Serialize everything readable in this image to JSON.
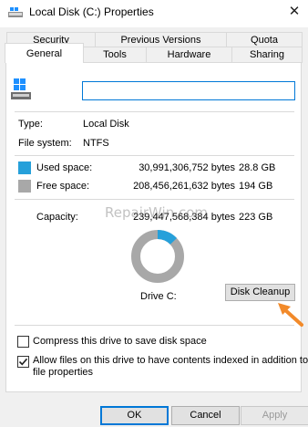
{
  "window": {
    "title": "Local Disk (C:) Properties",
    "close_glyph": "✕"
  },
  "tabs_top": [
    {
      "label": "Security"
    },
    {
      "label": "Previous Versions"
    },
    {
      "label": "Quota"
    }
  ],
  "tabs_bottom": [
    {
      "label": "General",
      "active": true
    },
    {
      "label": "Tools"
    },
    {
      "label": "Hardware"
    },
    {
      "label": "Sharing"
    }
  ],
  "general": {
    "drive_icon": "drive-icon",
    "name_value": "",
    "type_label": "Type:",
    "type_value": "Local Disk",
    "fs_label": "File system:",
    "fs_value": "NTFS",
    "used": {
      "label": "Used space:",
      "bytes": "30,991,306,752 bytes",
      "size": "28.8 GB",
      "color": "#26a0da"
    },
    "free": {
      "label": "Free space:",
      "bytes": "208,456,261,632 bytes",
      "size": "194 GB",
      "color": "#a8a8a8"
    },
    "capacity": {
      "label": "Capacity:",
      "bytes": "239,447,568,384 bytes",
      "size": "223 GB"
    },
    "used_fraction": 0.129,
    "drive_label": "Drive C:",
    "cleanup_button": "Disk Cleanup",
    "compress_label": "Compress this drive to save disk space",
    "compress_checked": false,
    "index_label_line1": "Allow files on this drive to have contents indexed in addition to",
    "index_label_line2": "file properties",
    "index_checked": true
  },
  "watermark": "RepairWin.com",
  "buttons": {
    "ok": "OK",
    "cancel": "Cancel",
    "apply": "Apply"
  }
}
